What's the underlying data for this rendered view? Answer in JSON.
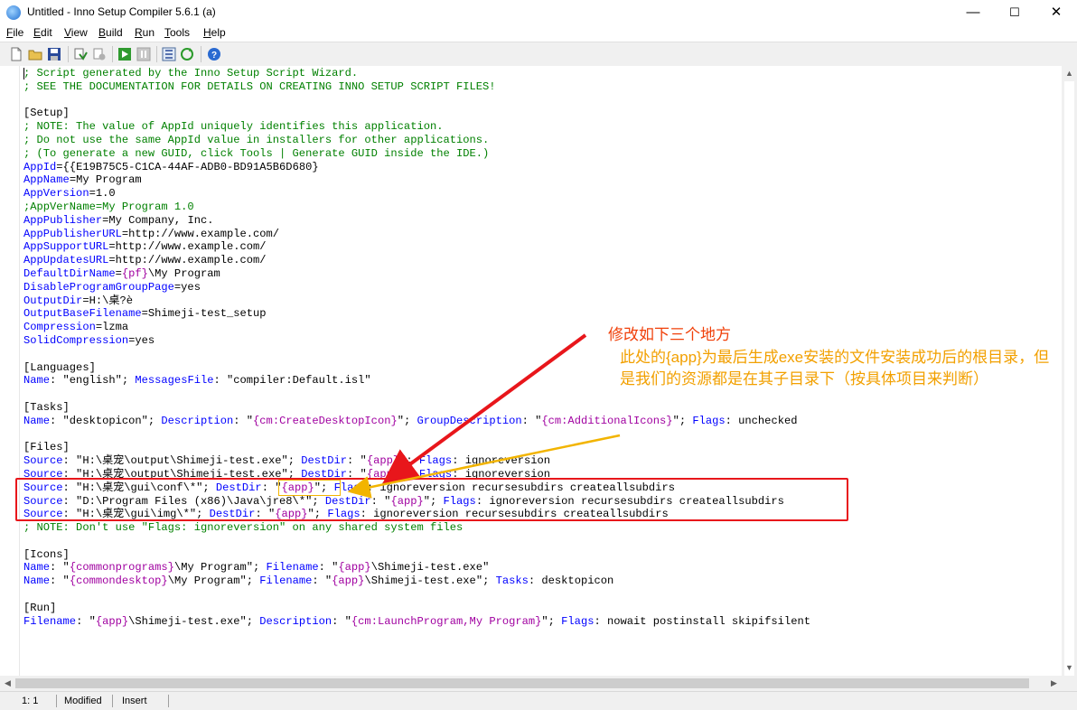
{
  "window": {
    "title": "Untitled - Inno Setup Compiler 5.6.1 (a)",
    "minimize": "—",
    "maximize": "☐",
    "close": "✕"
  },
  "menu": [
    {
      "u": "F",
      "rest": "ile"
    },
    {
      "u": "E",
      "rest": "dit"
    },
    {
      "u": "V",
      "rest": "iew"
    },
    {
      "u": "B",
      "rest": "uild"
    },
    {
      "u": "R",
      "rest": "un"
    },
    {
      "u": "T",
      "rest": "ools"
    },
    {
      "u": "H",
      "rest": "elp"
    }
  ],
  "toolbar_icons": [
    "new-file-icon",
    "open-folder-icon",
    "save-icon",
    "compile-icon",
    "stop-compile-icon",
    "run-icon",
    "pause-icon",
    "target-icon",
    "refresh-icon",
    "help-icon"
  ],
  "code_lines": [
    [
      [
        "comment",
        "; Script generated by the Inno Setup Script Wizard."
      ]
    ],
    [
      [
        "comment",
        "; SEE THE DOCUMENTATION FOR DETAILS ON CREATING INNO SETUP SCRIPT FILES!"
      ]
    ],
    [],
    [
      [
        "section",
        "[Setup]"
      ]
    ],
    [
      [
        "comment",
        "; NOTE: The value of AppId uniquely identifies this application."
      ]
    ],
    [
      [
        "comment",
        "; Do not use the same AppId value in installers for other applications."
      ]
    ],
    [
      [
        "comment",
        "; (To generate a new GUID, click Tools | Generate GUID inside the IDE.)"
      ]
    ],
    [
      [
        "key",
        "AppId"
      ],
      [
        "plain",
        "={{E19B75C5-C1CA-44AF-ADB0-BD91A5B6D680}"
      ]
    ],
    [
      [
        "key",
        "AppName"
      ],
      [
        "plain",
        "=My Program"
      ]
    ],
    [
      [
        "key",
        "AppVersion"
      ],
      [
        "plain",
        "=1.0"
      ]
    ],
    [
      [
        "comment",
        ";AppVerName=My Program 1.0"
      ]
    ],
    [
      [
        "key",
        "AppPublisher"
      ],
      [
        "plain",
        "=My Company, Inc."
      ]
    ],
    [
      [
        "key",
        "AppPublisherURL"
      ],
      [
        "plain",
        "=http://www.example.com/"
      ]
    ],
    [
      [
        "key",
        "AppSupportURL"
      ],
      [
        "plain",
        "=http://www.example.com/"
      ]
    ],
    [
      [
        "key",
        "AppUpdatesURL"
      ],
      [
        "plain",
        "=http://www.example.com/"
      ]
    ],
    [
      [
        "key",
        "DefaultDirName"
      ],
      [
        "plain",
        "="
      ],
      [
        "const",
        "{pf}"
      ],
      [
        "plain",
        "\\My Program"
      ]
    ],
    [
      [
        "key",
        "DisableProgramGroupPage"
      ],
      [
        "plain",
        "=yes"
      ]
    ],
    [
      [
        "key",
        "OutputDir"
      ],
      [
        "plain",
        "=H:\\桌?è"
      ]
    ],
    [
      [
        "key",
        "OutputBaseFilename"
      ],
      [
        "plain",
        "=Shimeji-test_setup"
      ]
    ],
    [
      [
        "key",
        "Compression"
      ],
      [
        "plain",
        "=lzma"
      ]
    ],
    [
      [
        "key",
        "SolidCompression"
      ],
      [
        "plain",
        "=yes"
      ]
    ],
    [],
    [
      [
        "section",
        "[Languages]"
      ]
    ],
    [
      [
        "key",
        "Name"
      ],
      [
        "plain",
        ": \"english\"; "
      ],
      [
        "key",
        "MessagesFile"
      ],
      [
        "plain",
        ": \"compiler:Default.isl\""
      ]
    ],
    [],
    [
      [
        "section",
        "[Tasks]"
      ]
    ],
    [
      [
        "key",
        "Name"
      ],
      [
        "plain",
        ": \"desktopicon\"; "
      ],
      [
        "key",
        "Description"
      ],
      [
        "plain",
        ": \""
      ],
      [
        "const",
        "{cm:CreateDesktopIcon}"
      ],
      [
        "plain",
        "\"; "
      ],
      [
        "key",
        "GroupDescription"
      ],
      [
        "plain",
        ": \""
      ],
      [
        "const",
        "{cm:AdditionalIcons}"
      ],
      [
        "plain",
        "\"; "
      ],
      [
        "key",
        "Flags"
      ],
      [
        "plain",
        ": unchecked"
      ]
    ],
    [],
    [
      [
        "section",
        "[Files]"
      ]
    ],
    [
      [
        "key",
        "Source"
      ],
      [
        "plain",
        ": \"H:\\桌宠\\output\\Shimeji-test.exe\"; "
      ],
      [
        "key",
        "DestDir"
      ],
      [
        "plain",
        ": \""
      ],
      [
        "const",
        "{app}"
      ],
      [
        "plain",
        "\"; "
      ],
      [
        "key",
        "Flags"
      ],
      [
        "plain",
        ": ignoreversion"
      ]
    ],
    [
      [
        "key",
        "Source"
      ],
      [
        "plain",
        ": \"H:\\桌宠\\output\\Shimeji-test.exe\"; "
      ],
      [
        "key",
        "DestDir"
      ],
      [
        "plain",
        ": \""
      ],
      [
        "const",
        "{app}"
      ],
      [
        "plain",
        "\"; "
      ],
      [
        "key",
        "Flags"
      ],
      [
        "plain",
        ": ignoreversion"
      ]
    ],
    [
      [
        "key",
        "Source"
      ],
      [
        "plain",
        ": \"H:\\桌宠\\gui\\conf\\*\"; "
      ],
      [
        "key",
        "DestDir"
      ],
      [
        "plain",
        ": \""
      ],
      [
        "const",
        "{app}"
      ],
      [
        "plain",
        "\"; "
      ],
      [
        "key",
        "Flags"
      ],
      [
        "plain",
        ": ignoreversion recursesubdirs createallsubdirs"
      ]
    ],
    [
      [
        "key",
        "Source"
      ],
      [
        "plain",
        ": \"D:\\Program Files (x86)\\Java\\jre8\\*\"; "
      ],
      [
        "key",
        "DestDir"
      ],
      [
        "plain",
        ": \""
      ],
      [
        "const",
        "{app}"
      ],
      [
        "plain",
        "\"; "
      ],
      [
        "key",
        "Flags"
      ],
      [
        "plain",
        ": ignoreversion recursesubdirs createallsubdirs"
      ]
    ],
    [
      [
        "key",
        "Source"
      ],
      [
        "plain",
        ": \"H:\\桌宠\\gui\\img\\*\"; "
      ],
      [
        "key",
        "DestDir"
      ],
      [
        "plain",
        ": \""
      ],
      [
        "const",
        "{app}"
      ],
      [
        "plain",
        "\"; "
      ],
      [
        "key",
        "Flags"
      ],
      [
        "plain",
        ": ignoreversion recursesubdirs createallsubdirs"
      ]
    ],
    [
      [
        "comment",
        "; NOTE: Don't use \"Flags: ignoreversion\" on any shared system files"
      ]
    ],
    [],
    [
      [
        "section",
        "[Icons]"
      ]
    ],
    [
      [
        "key",
        "Name"
      ],
      [
        "plain",
        ": \""
      ],
      [
        "const",
        "{commonprograms}"
      ],
      [
        "plain",
        "\\My Program\"; "
      ],
      [
        "key",
        "Filename"
      ],
      [
        "plain",
        ": \""
      ],
      [
        "const",
        "{app}"
      ],
      [
        "plain",
        "\\Shimeji-test.exe\""
      ]
    ],
    [
      [
        "key",
        "Name"
      ],
      [
        "plain",
        ": \""
      ],
      [
        "const",
        "{commondesktop}"
      ],
      [
        "plain",
        "\\My Program\"; "
      ],
      [
        "key",
        "Filename"
      ],
      [
        "plain",
        ": \""
      ],
      [
        "const",
        "{app}"
      ],
      [
        "plain",
        "\\Shimeji-test.exe\"; "
      ],
      [
        "key",
        "Tasks"
      ],
      [
        "plain",
        ": desktopicon"
      ]
    ],
    [],
    [
      [
        "section",
        "[Run]"
      ]
    ],
    [
      [
        "key",
        "Filename"
      ],
      [
        "plain",
        ": \""
      ],
      [
        "const",
        "{app}"
      ],
      [
        "plain",
        "\\Shimeji-test.exe\"; "
      ],
      [
        "key",
        "Description"
      ],
      [
        "plain",
        ": \""
      ],
      [
        "const",
        "{cm:LaunchProgram,My Program}"
      ],
      [
        "plain",
        "\"; "
      ],
      [
        "key",
        "Flags"
      ],
      [
        "plain",
        ": nowait postinstall skipifsilent"
      ]
    ]
  ],
  "status": {
    "position": "1:   1",
    "modified": "Modified",
    "mode": "Insert"
  },
  "annotation": {
    "title": "修改如下三个地方",
    "body": "此处的{app}为最后生成exe安装的文件安装成功后的根目录，但是我们的资源都是在其子目录下（按具体项目来判断）"
  },
  "colors": {
    "comment": "#008000",
    "key": "#0000ff",
    "const": "#a000a0",
    "red_annotation": "#e8161b",
    "yellow_annotation": "#f2b400"
  }
}
